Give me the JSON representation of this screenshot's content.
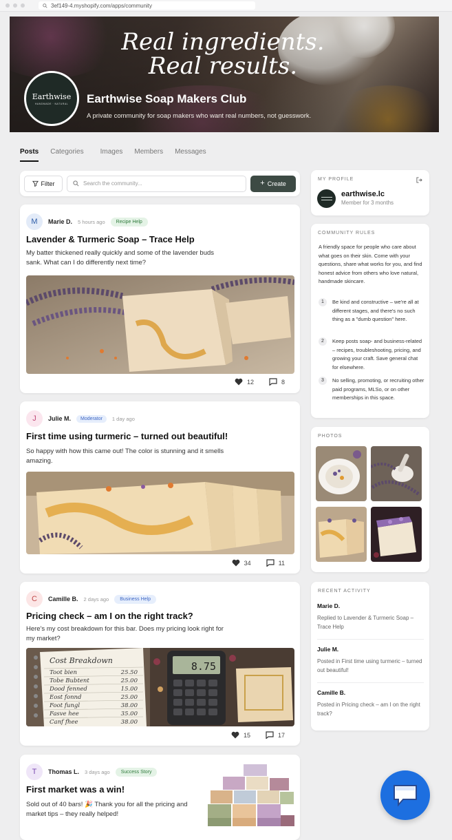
{
  "browser": {
    "url": "3ef149-4.myshopify.com/apps/community"
  },
  "hero": {
    "tagline_line1": "Real ingredients.",
    "tagline_line2": "Real results.",
    "logo_text": "Earthwise",
    "logo_sub": "HANDMADE · NATURAL",
    "club_name": "Earthwise Soap Makers Club",
    "club_desc": "A private community for soap makers who want real numbers, not guesswork."
  },
  "tabs": [
    "Posts",
    "Categories",
    "Images",
    "Members",
    "Messages"
  ],
  "toolbar": {
    "filter_label": "Filter",
    "search_placeholder": "Search the community...",
    "create_label": "Create"
  },
  "posts": [
    {
      "initial": "M",
      "author": "Marie D.",
      "time": "5 hours ago",
      "badge": "Recipe Help",
      "title": "Lavender & Turmeric Soap – Trace Help",
      "body": "My batter thickened really quickly and some of the lavender buds sank. What can I do differently next time?",
      "likes": "12",
      "comments": "8"
    },
    {
      "initial": "J",
      "author": "Julie M.",
      "time": "1 day ago",
      "badge": "Moderator",
      "title": "First time using turmeric – turned out beautiful!",
      "body": "So happy with how this came out! The color is stunning and it smells amazing.",
      "likes": "34",
      "comments": "11"
    },
    {
      "initial": "C",
      "author": "Camille B.",
      "time": "2 days ago",
      "badge": "Business Help",
      "title": "Pricing check – am I on the right track?",
      "body": "Here's my cost breakdown for this bar. Does my pricing look right for my market?",
      "likes": "15",
      "comments": "17"
    },
    {
      "initial": "T",
      "author": "Thomas L.",
      "time": "3 days ago",
      "badge": "Success Story",
      "title": "First market was a win!",
      "body": "Sold out of 40 bars! 🎉 Thank you for all the pricing and market tips – they really helped!"
    }
  ],
  "notebook": {
    "title": "Cost Breakdown",
    "rows": [
      {
        "item": "Toot bien",
        "cost": "25.50"
      },
      {
        "item": "Tobe Bubtent",
        "cost": "25.00"
      },
      {
        "item": "Dood fenned",
        "cost": "15.00"
      },
      {
        "item": "Eost fonnd",
        "cost": "25.00"
      },
      {
        "item": "Foot fungl",
        "cost": "38.00"
      },
      {
        "item": "Fasve hee",
        "cost": "35.00"
      },
      {
        "item": "Canf fhee",
        "cost": "38.00"
      }
    ],
    "calc_display": "8.75"
  },
  "profile": {
    "heading": "MY PROFILE",
    "username": "earthwise.lc",
    "since": "Member for 3 months"
  },
  "rules": {
    "heading": "COMMUNITY RULES",
    "intro": "A friendly space for people who care about what goes on their skin. Come with your questions, share what works for you, and find honest advice from others who love natural, handmade skincare.",
    "items": [
      {
        "n": "1",
        "text": "Be kind and constructive – we're all at different stages, and there's no such thing as a \"dumb question\" here."
      },
      {
        "n": "2",
        "text": "Keep posts soap- and business-related – recipes, troubleshooting, pricing, and growing your craft. Save general chat for elsewhere."
      },
      {
        "n": "3",
        "text": "No selling, promoting, or recruiting other paid programs, MLSo, or on other memberships in this space."
      }
    ]
  },
  "photos": {
    "heading": "PHOTOS"
  },
  "activity": {
    "heading": "RECENT ACTIVITY",
    "items": [
      {
        "name": "Marie D.",
        "text": "Replied to Lavender & Turmeric Soap – Trace Help"
      },
      {
        "name": "Julie M.",
        "text": "Posted in First time using turmeric – turned out beautiful!"
      },
      {
        "name": "Camille B.",
        "text": "Posted in Pricing check – am I on the right track?"
      }
    ]
  },
  "colors": {
    "accent_dark": "#3d4a44",
    "badge_recipe_bg": "#e4f3e6",
    "badge_recipe_fg": "#2f7a3c",
    "badge_mod_bg": "#e6eefc",
    "badge_mod_fg": "#3d66c4",
    "badge_biz_bg": "#e6eefc",
    "badge_biz_fg": "#3d66c4",
    "badge_success_bg": "#e4f3e6",
    "badge_success_fg": "#2f7a3c",
    "chat_button": "#1d6fe0"
  }
}
